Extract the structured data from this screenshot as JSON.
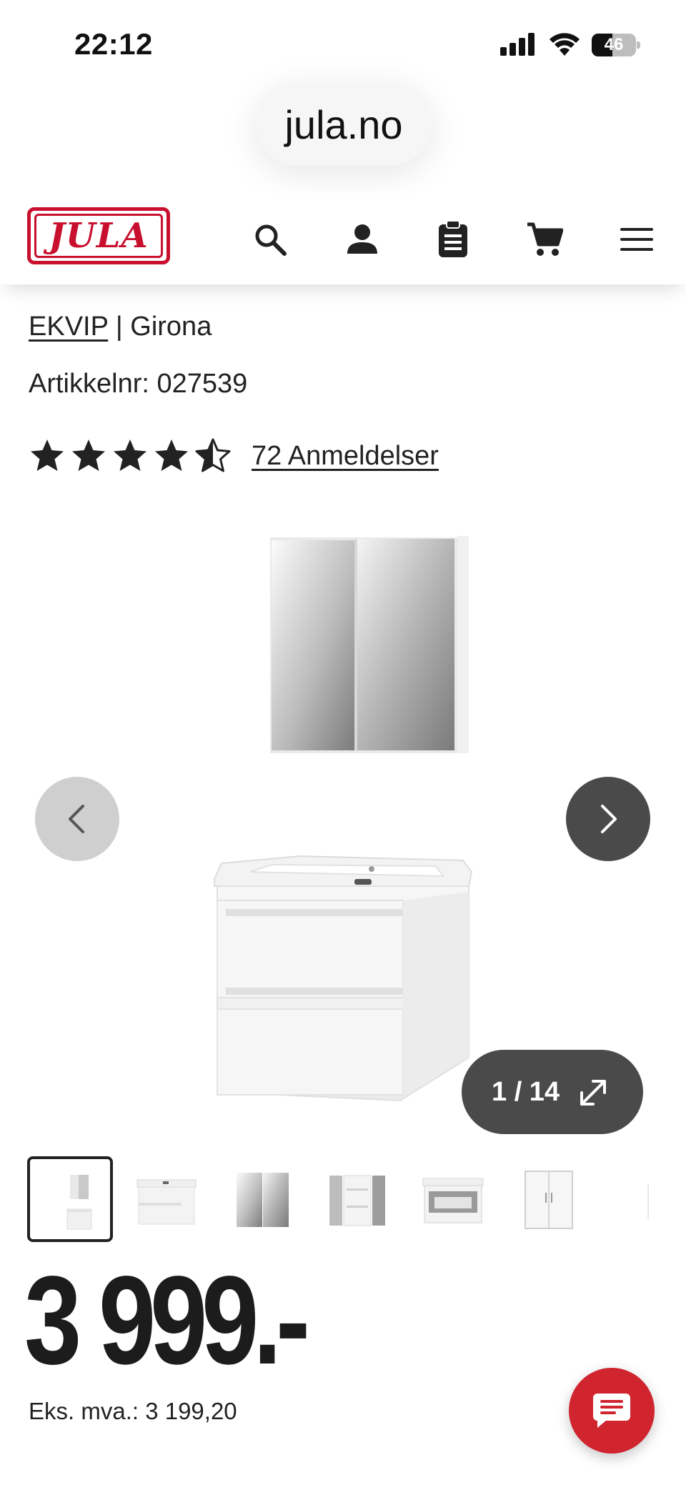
{
  "status_bar": {
    "time": "22:12",
    "battery_percent": "46",
    "battery_level": 0.46
  },
  "browser": {
    "url": "jula.no"
  },
  "header": {
    "logo_text": "JULA",
    "icons": [
      "search-icon",
      "account-icon",
      "list-icon",
      "cart-icon",
      "menu-icon"
    ]
  },
  "product": {
    "brand": "EKVIP",
    "separator": " | ",
    "name": "Girona",
    "article_label": "Artikkelnr: ",
    "article_number": "027539",
    "rating": 4.5,
    "rating_max": 5,
    "reviews_label": "72 Anmeldelser",
    "price": "3 999.-",
    "ex_vat_label": "Eks. mva.: ",
    "ex_vat_value": "3 199,20"
  },
  "gallery": {
    "counter": "1 / 14",
    "current": 1,
    "total": 14
  },
  "colors": {
    "brand_red": "#c8102e",
    "chat_red": "#d0242f",
    "dark_button": "#4a4a4a",
    "light_button": "#cfcfcf",
    "star": "#222222"
  }
}
